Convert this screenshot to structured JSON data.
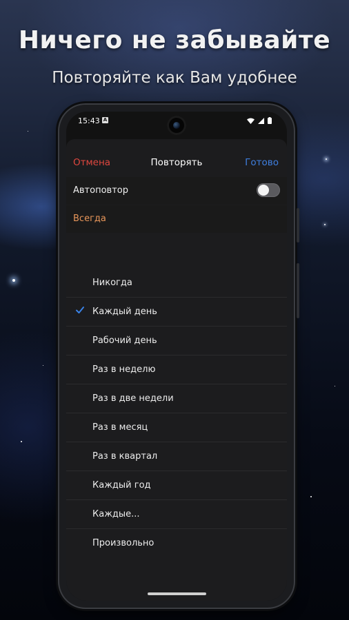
{
  "promo": {
    "headline": "Ничего не забывайте",
    "subheadline": "Повторяйте как Вам удобнее"
  },
  "status_bar": {
    "time": "15:43",
    "notification_glyph": "A",
    "icons": [
      "wifi-icon",
      "signal-icon",
      "battery-icon"
    ]
  },
  "nav": {
    "cancel_label": "Отмена",
    "title": "Повторять",
    "done_label": "Готово"
  },
  "autorepeat": {
    "label": "Автоповтор",
    "enabled": false
  },
  "duration": {
    "label": "Всегда"
  },
  "options": [
    {
      "label": "Никогда",
      "selected": false
    },
    {
      "label": "Каждый день",
      "selected": true
    },
    {
      "label": "Рабочий день",
      "selected": false
    },
    {
      "label": "Раз в неделю",
      "selected": false
    },
    {
      "label": "Раз в две недели",
      "selected": false
    },
    {
      "label": "Раз в месяц",
      "selected": false
    },
    {
      "label": "Раз в квартал",
      "selected": false
    },
    {
      "label": "Каждый год",
      "selected": false
    },
    {
      "label": "Каждые...",
      "selected": false
    },
    {
      "label": "Произвольно",
      "selected": false
    }
  ],
  "colors": {
    "cancel": "#e0473f",
    "done": "#3f7fe0",
    "duration_text": "#e8965a",
    "check": "#3a82e6"
  }
}
